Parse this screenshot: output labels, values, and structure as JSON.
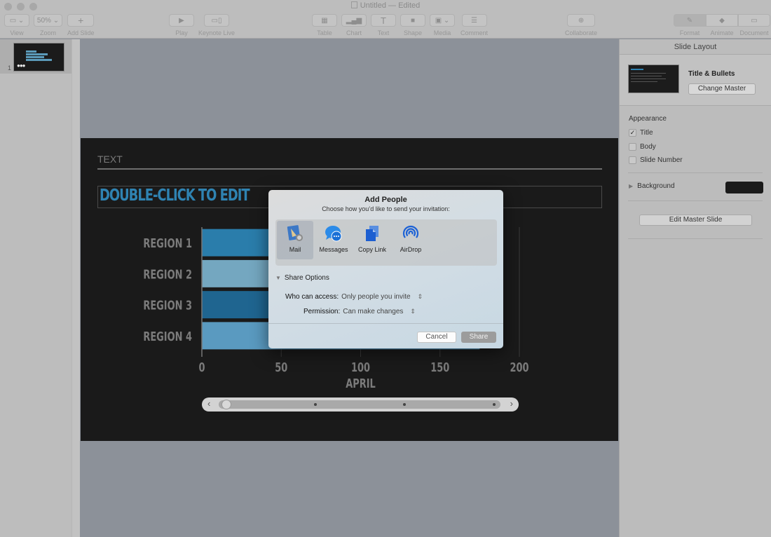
{
  "window": {
    "title": "Untitled — Edited"
  },
  "toolbar": {
    "items": [
      {
        "label": "View",
        "icon": "view-icon"
      },
      {
        "label": "Zoom",
        "value": "50%"
      },
      {
        "label": "Add Slide",
        "icon": "plus-icon"
      },
      {
        "label": "Play",
        "icon": "play-icon"
      },
      {
        "label": "Keynote Live",
        "icon": "keynote-live-icon"
      },
      {
        "label": "Table",
        "icon": "table-icon"
      },
      {
        "label": "Chart",
        "icon": "chart-icon"
      },
      {
        "label": "Text",
        "icon": "text-icon"
      },
      {
        "label": "Shape",
        "icon": "shape-icon"
      },
      {
        "label": "Media",
        "icon": "media-icon"
      },
      {
        "label": "Comment",
        "icon": "comment-icon"
      },
      {
        "label": "Collaborate",
        "icon": "collaborate-icon"
      }
    ],
    "inspector_tabs": [
      {
        "label": "Format",
        "icon": "format-brush-icon",
        "active": true
      },
      {
        "label": "Animate",
        "icon": "animate-diamond-icon"
      },
      {
        "label": "Document",
        "icon": "document-icon"
      }
    ]
  },
  "navigator": {
    "slide_number": "1",
    "thumb_dots": "●●●"
  },
  "slide": {
    "header_text": "TEXT",
    "title_placeholder": "DOUBLE-CLICK TO EDIT",
    "chart_data": {
      "type": "bar",
      "orientation": "horizontal",
      "categories": [
        "REGION 1",
        "REGION 2",
        "REGION 3",
        "REGION 4"
      ],
      "series": [
        {
          "name": "April",
          "values": [
            70,
            150,
            125,
            175
          ]
        }
      ],
      "xlabel": "APRIL",
      "xlim": [
        0,
        200
      ],
      "xticks": [
        "0",
        "50",
        "100",
        "150",
        "200"
      ],
      "bar_colors": [
        "#2a7dab",
        "#74a7c0",
        "#1f6590",
        "#5a9ac0"
      ],
      "grid": true
    },
    "scrubber": {
      "left_arrow": "‹",
      "right_arrow": "›",
      "position": 0,
      "stops": 4
    }
  },
  "inspector": {
    "header": "Slide Layout",
    "layout_name": "Title & Bullets",
    "change_master_label": "Change Master",
    "appearance_title": "Appearance",
    "appearance": [
      {
        "label": "Title",
        "checked": true,
        "mark": "✓"
      },
      {
        "label": "Body",
        "checked": false,
        "mark": ""
      },
      {
        "label": "Slide Number",
        "checked": false,
        "mark": ""
      }
    ],
    "background_label": "Background",
    "background_color": "#1a1a1a",
    "edit_master_label": "Edit Master Slide"
  },
  "dialog": {
    "title": "Add People",
    "subtitle": "Choose how you’d like to send your invitation:",
    "share_methods": [
      {
        "label": "Mail",
        "icon": "mail-icon",
        "selected": true
      },
      {
        "label": "Messages",
        "icon": "messages-icon"
      },
      {
        "label": "Copy Link",
        "icon": "copy-link-icon"
      },
      {
        "label": "AirDrop",
        "icon": "airdrop-icon"
      }
    ],
    "options_header": "Share Options",
    "who_can_access_label": "Who can access:",
    "who_can_access_value": "Only people you invite",
    "permission_label": "Permission:",
    "permission_value": "Can make changes",
    "stepper_glyph": "⌃⌄",
    "cancel_label": "Cancel",
    "share_label": "Share"
  }
}
